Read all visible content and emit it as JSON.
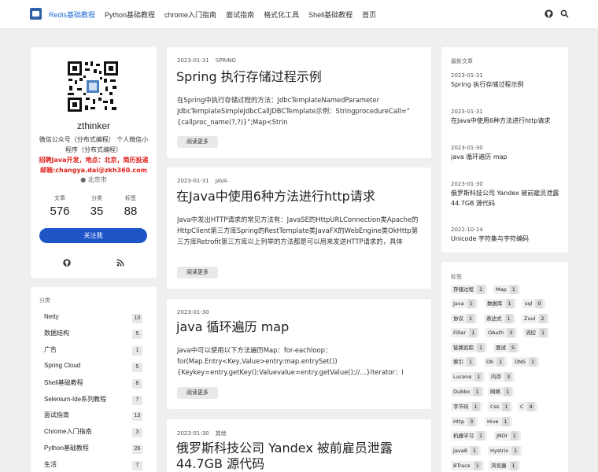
{
  "nav": {
    "items": [
      "Redis基础教程",
      "Python基础教程",
      "chrome入门指南",
      "面试指南",
      "格式化工具",
      "Shell基础教程",
      "首页"
    ]
  },
  "profile": {
    "name": "zthinker",
    "desc": "微信公众号（分布式编程） 个人微信小程序（分布式编程）",
    "hire": "招聘Java开发，地点：北京，简历投递邮箱:changya.dai@zkh360.com",
    "location": "北京市",
    "stats": [
      {
        "label": "文章",
        "value": "576"
      },
      {
        "label": "分类",
        "value": "35"
      },
      {
        "label": "标签",
        "value": "88"
      }
    ],
    "follow": "关注我"
  },
  "categories": {
    "title": "分类",
    "items": [
      {
        "name": "Netty",
        "count": "10"
      },
      {
        "name": "数据结构",
        "count": "5"
      },
      {
        "name": "广告",
        "count": "1"
      },
      {
        "name": "Spring Cloud",
        "count": "5"
      },
      {
        "name": "Shell基础教程",
        "count": "8"
      },
      {
        "name": "Selenium-Ide系列教程",
        "count": "7"
      },
      {
        "name": "面试指南",
        "count": "13"
      },
      {
        "name": "Chrome入门指南",
        "count": "3"
      },
      {
        "name": "Python基础教程",
        "count": "26"
      },
      {
        "name": "生活",
        "count": "7"
      }
    ]
  },
  "posts": [
    {
      "date": "2023-01-31",
      "tag": "SPRING",
      "title": "Spring 执行存储过程示例",
      "excerpt": "在Spring中执行存储过程的方法：JdbcTemplateNamedParameter JdbcTemplateSimpleJdbcCallJDBCTemplate示例：StringprocedureCall=\"{callproc_name(?,?)}\";Map<Strin",
      "more": "阅读更多"
    },
    {
      "date": "2023-01-31",
      "tag": "JAVA",
      "title": "在Java中使用6种方法进行http请求",
      "excerpt": "Java中发出HTTP请求的常见方法有：JavaSE的HttpURLConnection类Apache的HttpClient第三方库Spring的RestTemplate类JavaFX的WebEngine类OkHttp第三方库Retrofit第三方库以上列举的方法都是可以用来发送HTTP请求的，具体",
      "more": "阅读更多"
    },
    {
      "date": "2023-01-30",
      "tag": "",
      "title": "java 循环遍历 map",
      "excerpt": "Java中可以使用以下方法遍历Map：for-eachloop：for(Map.Entry<Key,Value>entry:map.entrySet()){Keykey=entry.getKey();Valuevalue=entry.getValue();//...}Iterator：I",
      "more": "阅读更多"
    },
    {
      "date": "2023-01-30",
      "tag": "其他",
      "title": "俄罗斯科技公司 Yandex 被前雇员泄露 44.7GB 源代码",
      "excerpt": "",
      "more": ""
    }
  ],
  "recent": {
    "title": "最新文章",
    "items": [
      {
        "date": "2023-01-31",
        "title": "Spring 执行存储过程示例"
      },
      {
        "date": "2023-01-31",
        "title": "在Java中使用6种方法进行http请求"
      },
      {
        "date": "2023-01-30",
        "title": "java 循环遍历 map"
      },
      {
        "date": "2023-01-30",
        "title": "俄罗斯科技公司 Yandex 被前雇员泄露 44.7GB 源代码"
      },
      {
        "date": "2022-10-14",
        "title": "Unicode 字符集与字符编码"
      }
    ]
  },
  "tags": {
    "title": "标签",
    "items": [
      {
        "name": "存储过程",
        "count": "1"
      },
      {
        "name": "Map",
        "count": "1"
      },
      {
        "name": "Java",
        "count": "1"
      },
      {
        "name": "数据库",
        "count": "1"
      },
      {
        "name": "sql",
        "count": "0"
      },
      {
        "name": "协议",
        "count": "1"
      },
      {
        "name": "表达式",
        "count": "1"
      },
      {
        "name": "Zuul",
        "count": "2"
      },
      {
        "name": "Filter",
        "count": "1"
      },
      {
        "name": "OAuth",
        "count": "3"
      },
      {
        "name": "流控",
        "count": "1"
      },
      {
        "name": "链路追踪",
        "count": "1"
      },
      {
        "name": "面试",
        "count": "5"
      },
      {
        "name": "索引",
        "count": "1"
      },
      {
        "name": "Db",
        "count": "1"
      },
      {
        "name": "DNS",
        "count": "1"
      },
      {
        "name": "Lucene",
        "count": "1"
      },
      {
        "name": "内存",
        "count": "3"
      },
      {
        "name": "Dubbo",
        "count": "1"
      },
      {
        "name": "网络",
        "count": "1"
      },
      {
        "name": "字节码",
        "count": "1"
      },
      {
        "name": "Css",
        "count": "1"
      },
      {
        "name": "C",
        "count": "4"
      },
      {
        "name": "Http",
        "count": "3"
      },
      {
        "name": "Hive",
        "count": "1"
      },
      {
        "name": "机器学习",
        "count": "1"
      },
      {
        "name": "JNDI",
        "count": "1"
      },
      {
        "name": "Java8",
        "count": "1"
      },
      {
        "name": "Hystrix",
        "count": "1"
      },
      {
        "name": "BTrace",
        "count": "1"
      },
      {
        "name": "浏览器",
        "count": "1"
      }
    ]
  }
}
